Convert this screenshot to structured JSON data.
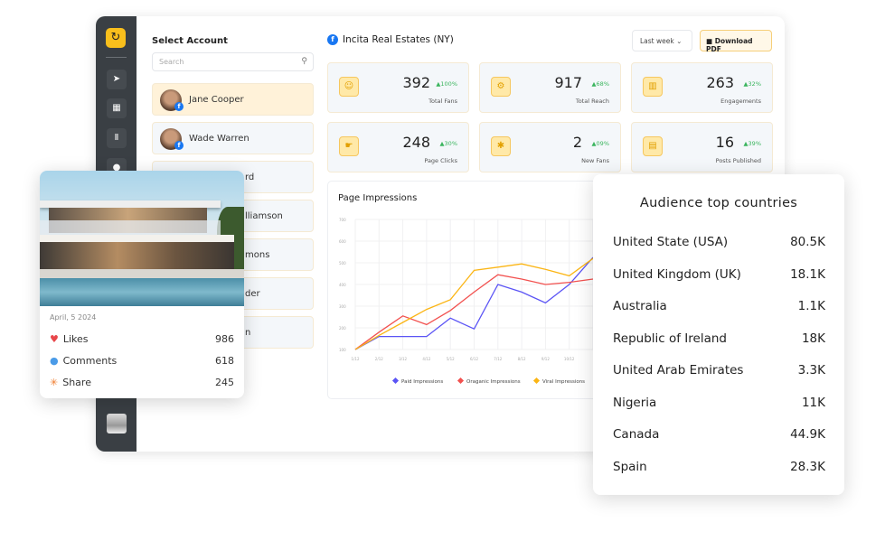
{
  "sidebar": {
    "items": [
      "send-icon",
      "calendar-icon",
      "library-icon",
      "user-icon"
    ]
  },
  "accounts": {
    "title": "Select Account",
    "search_placeholder": "Search",
    "items": [
      {
        "name": "Jane Cooper",
        "selected": true
      },
      {
        "name": "Wade Warren"
      },
      {
        "name": "rd"
      },
      {
        "name": "lliamson"
      },
      {
        "name": "mons"
      },
      {
        "name": "der"
      },
      {
        "name": "n"
      }
    ]
  },
  "header": {
    "page_name": "Incita Real Estates (NY)",
    "range": "Last week",
    "download": "Download PDF"
  },
  "stats": [
    {
      "value": "392",
      "change": "100%",
      "label": "Total Fans",
      "icon": "fans-icon"
    },
    {
      "value": "917",
      "change": "68%",
      "label": "Total Reach",
      "icon": "reach-icon"
    },
    {
      "value": "263",
      "change": "32%",
      "label": "Engagements",
      "icon": "engagement-icon"
    },
    {
      "value": "248",
      "change": "30%",
      "label": "Page Clicks",
      "icon": "click-icon"
    },
    {
      "value": "2",
      "change": "09%",
      "label": "New Fans",
      "icon": "new-fans-icon"
    },
    {
      "value": "16",
      "change": "39%",
      "label": "Posts Published",
      "icon": "posts-icon"
    }
  ],
  "chart_data": {
    "type": "line",
    "title": "Page Impressions",
    "categories": [
      "1/12",
      "2/12",
      "3/12",
      "4/12",
      "5/12",
      "6/12",
      "7/12",
      "8/12",
      "9/12",
      "10/12",
      ""
    ],
    "ylim": [
      100,
      700
    ],
    "yticks": [
      100,
      200,
      300,
      400,
      500,
      600,
      700
    ],
    "grid": true,
    "legend": "bottom",
    "series": [
      {
        "name": "Paid Impressions",
        "color": "#5b54f5",
        "values": [
          100,
          160,
          160,
          160,
          245,
          195,
          400,
          365,
          315,
          400,
          525
        ]
      },
      {
        "name": "Oraganic Impressions",
        "color": "#f2514f",
        "values": [
          100,
          180,
          255,
          215,
          280,
          365,
          445,
          425,
          400,
          410,
          425
        ]
      },
      {
        "name": "Viral Impressions",
        "color": "#fbb514",
        "values": [
          100,
          165,
          225,
          285,
          330,
          465,
          480,
          495,
          470,
          440,
          520
        ]
      }
    ]
  },
  "post": {
    "date": "April, 5 2024",
    "rows": [
      {
        "label": "Likes",
        "value": "986",
        "icon": "heart-icon",
        "color": "#e8464a"
      },
      {
        "label": "Comments",
        "value": "618",
        "icon": "comment-icon",
        "color": "#4a9be8"
      },
      {
        "label": "Share",
        "value": "245",
        "icon": "share-icon",
        "color": "#f07a2a"
      }
    ]
  },
  "countries": {
    "title": "Audience top countries",
    "items": [
      {
        "name": "United State (USA)",
        "value": "80.5K"
      },
      {
        "name": "United Kingdom (UK)",
        "value": "18.1K"
      },
      {
        "name": "Australia",
        "value": "1.1K"
      },
      {
        "name": "Republic of Ireland",
        "value": "18K"
      },
      {
        "name": "United Arab Emirates",
        "value": "3.3K"
      },
      {
        "name": "Nigeria",
        "value": "11K"
      },
      {
        "name": "Canada",
        "value": "44.9K"
      },
      {
        "name": "Spain",
        "value": "28.3K"
      }
    ]
  }
}
